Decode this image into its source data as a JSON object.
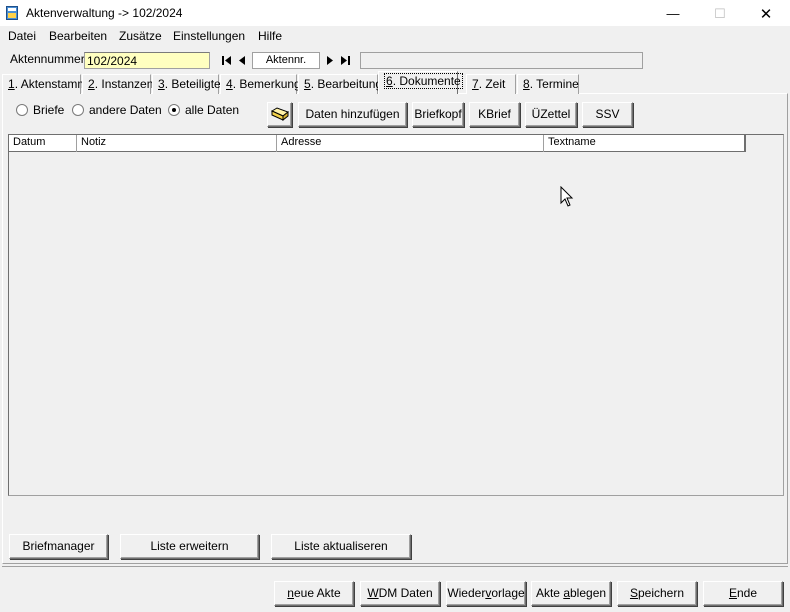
{
  "window": {
    "title": "Aktenverwaltung -> 102/2024",
    "minimize_glyph": "—",
    "maximize_glyph": "☐",
    "close_glyph": "✕"
  },
  "menu": [
    "Datei",
    "Bearbeiten",
    "Zusätze",
    "Einstellungen",
    "Hilfe"
  ],
  "record": {
    "label": "Aktennummer :",
    "value": "102/2024",
    "nav_label": "Aktennr.",
    "info": ""
  },
  "tabs": [
    {
      "key": "1",
      "rest": ". Aktenstamm"
    },
    {
      "key": "2",
      "rest": ". Instanzen"
    },
    {
      "key": "3",
      "rest": ". Beteiligte"
    },
    {
      "key": "4",
      "rest": ". Bemerkung"
    },
    {
      "key": "5",
      "rest": ". Bearbeitung"
    },
    {
      "key": "6",
      "rest": ". Dokumente"
    },
    {
      "key": "7",
      "rest": ". Zeit"
    },
    {
      "key": "8",
      "rest": ". Termine"
    }
  ],
  "active_tab": "6",
  "filter": {
    "options": [
      "Briefe",
      "andere Daten",
      "alle Daten"
    ],
    "selected": "alle Daten"
  },
  "toolbar": {
    "add_data": "Daten hinzufügen",
    "briefkopf": "Briefkopf",
    "kbrief": "KBrief",
    "uezettel": "ÜZettel",
    "ssv": "SSV"
  },
  "grid": {
    "columns": [
      "Datum",
      "Notiz",
      "Adresse",
      "Textname"
    ],
    "rows": []
  },
  "panel_buttons": {
    "briefmanager": "Briefmanager",
    "liste_erweitern": "Liste erweitern",
    "liste_aktualisieren": "Liste aktualiseren"
  },
  "footer_buttons": {
    "neue_akte": {
      "pre": "",
      "u": "n",
      "post": "eue Akte"
    },
    "wdm_daten": {
      "pre": "",
      "u": "W",
      "post": "DM Daten"
    },
    "wiedervorlage": {
      "pre": "Wieder",
      "u": "v",
      "post": "orlage"
    },
    "akte_ablegen": {
      "pre": "Akte ",
      "u": "a",
      "post": "blegen"
    },
    "speichern": {
      "pre": "",
      "u": "S",
      "post": "peichern"
    },
    "ende": {
      "pre": "",
      "u": "E",
      "post": "nde"
    }
  }
}
